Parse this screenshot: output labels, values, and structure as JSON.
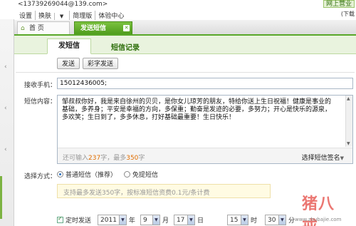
{
  "header": {
    "account": "<13739269044@139.com>",
    "nav": [
      "设置",
      "换肤",
      "简理版",
      "体验中心"
    ],
    "corner_link": "网上营业",
    "corner_text": "(下载"
  },
  "tabs": {
    "home": "首 页",
    "send_sms": "发送短信"
  },
  "subtabs": {
    "compose": "发短信",
    "records": "短信记录"
  },
  "buttons": {
    "send": "发送",
    "send_mms": "彩字发送"
  },
  "form": {
    "recipient_label": "接收手机：",
    "recipient_value": "15012436005;",
    "content_label": "短信内容：",
    "content_value": "邹叔叔你好，我是来自徐州的贝贝，是你女儿琼芳的朋友，特给你送上生日祝福！健康是事业的基础，多养身；平安是幸福的方向，多保重；勤奋是发迹的必要，多努力；开心是快乐的源泉，多欢笑；生日到了，多多休息，打好基础最重要！生日快乐！",
    "counter_prefix": "还可输入",
    "counter_remaining": "237",
    "counter_middle": "字，最多",
    "counter_max": "350",
    "counter_suffix": "字",
    "signature_picker": "选择短信签名",
    "send_mode_label": "选择方式：",
    "send_mode_options": [
      "普通短信（推荐）",
      "免提短信"
    ],
    "send_mode_selected": "普通短信（推荐）",
    "tip": "支持最多发送350字，按标准短信资费0.1元/条计费",
    "scheduled_label": "定时发送",
    "scheduled_checked": true,
    "year": "2011",
    "year_unit": "年",
    "month": "9",
    "month_unit": "月",
    "day": "17",
    "day_unit": "日",
    "hour": "15",
    "hour_unit": "时",
    "minute": "30",
    "minute_unit": "分"
  },
  "watermark": {
    "text": "猪八戒",
    "url": "www.zhubajie.com"
  },
  "colors": {
    "accent": "#5aa82a",
    "counter_highlight": "#e06d00"
  }
}
